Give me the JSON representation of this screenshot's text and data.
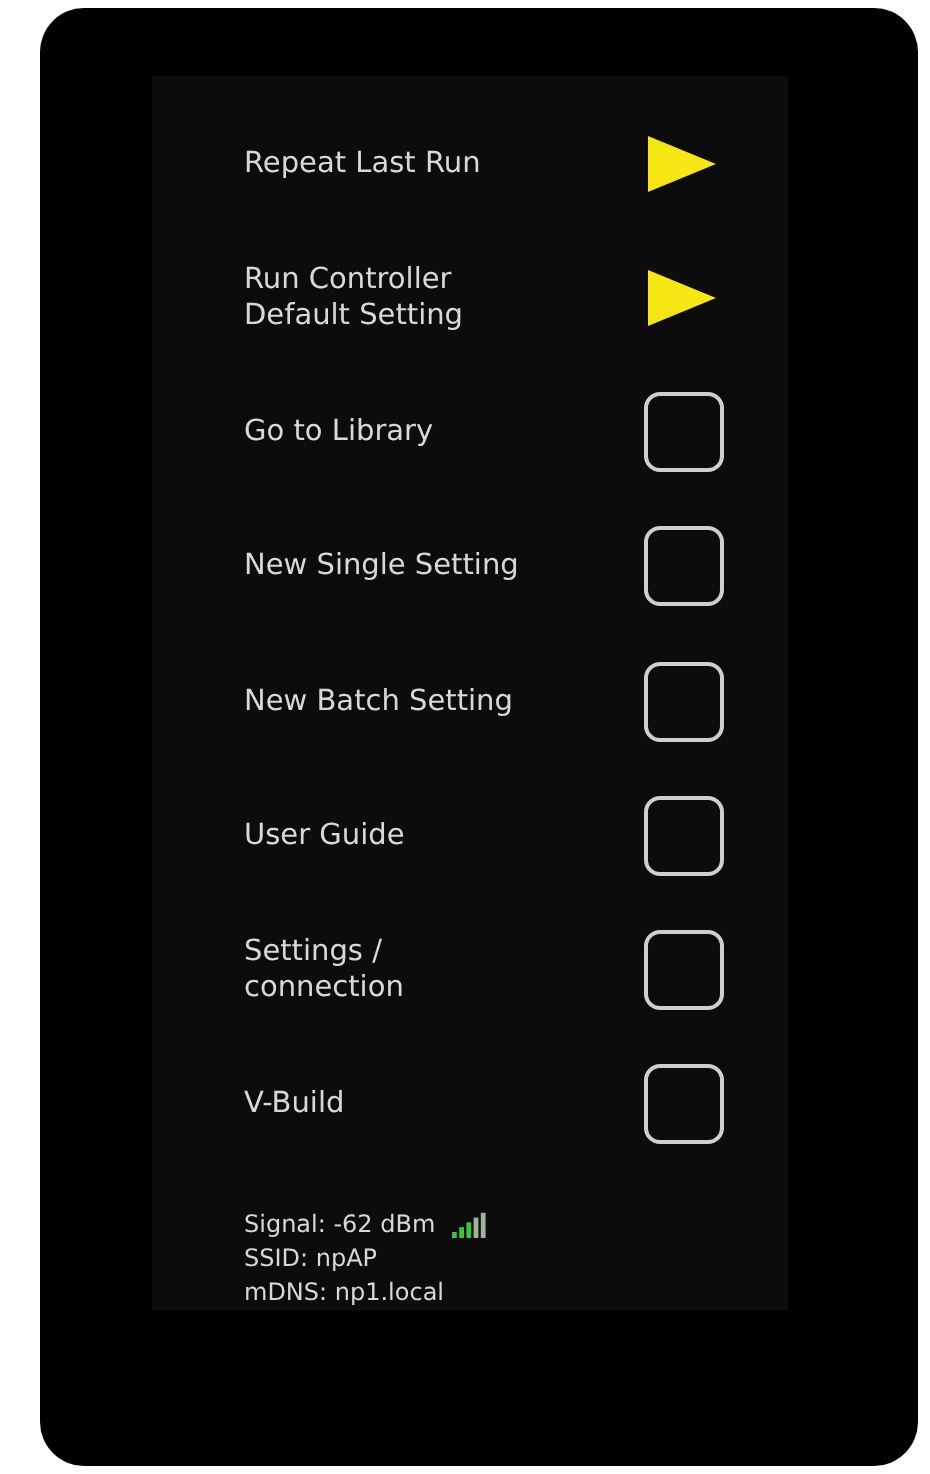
{
  "menu": [
    {
      "label": "Repeat Last Run",
      "kind": "play"
    },
    {
      "label": "Run Controller\nDefault Setting",
      "kind": "play"
    },
    {
      "label": "Go to Library",
      "kind": "box"
    },
    {
      "label": "New Single Setting",
      "kind": "box"
    },
    {
      "label": "New Batch Setting",
      "kind": "box"
    },
    {
      "label": "User Guide",
      "kind": "box"
    },
    {
      "label": "Settings /\nconnection",
      "kind": "box"
    },
    {
      "label": "V-Build",
      "kind": "box"
    }
  ],
  "status": {
    "signal": "Signal: -62 dBm",
    "ssid": "SSID: npAP",
    "mdns": "mDNS: np1.local"
  }
}
